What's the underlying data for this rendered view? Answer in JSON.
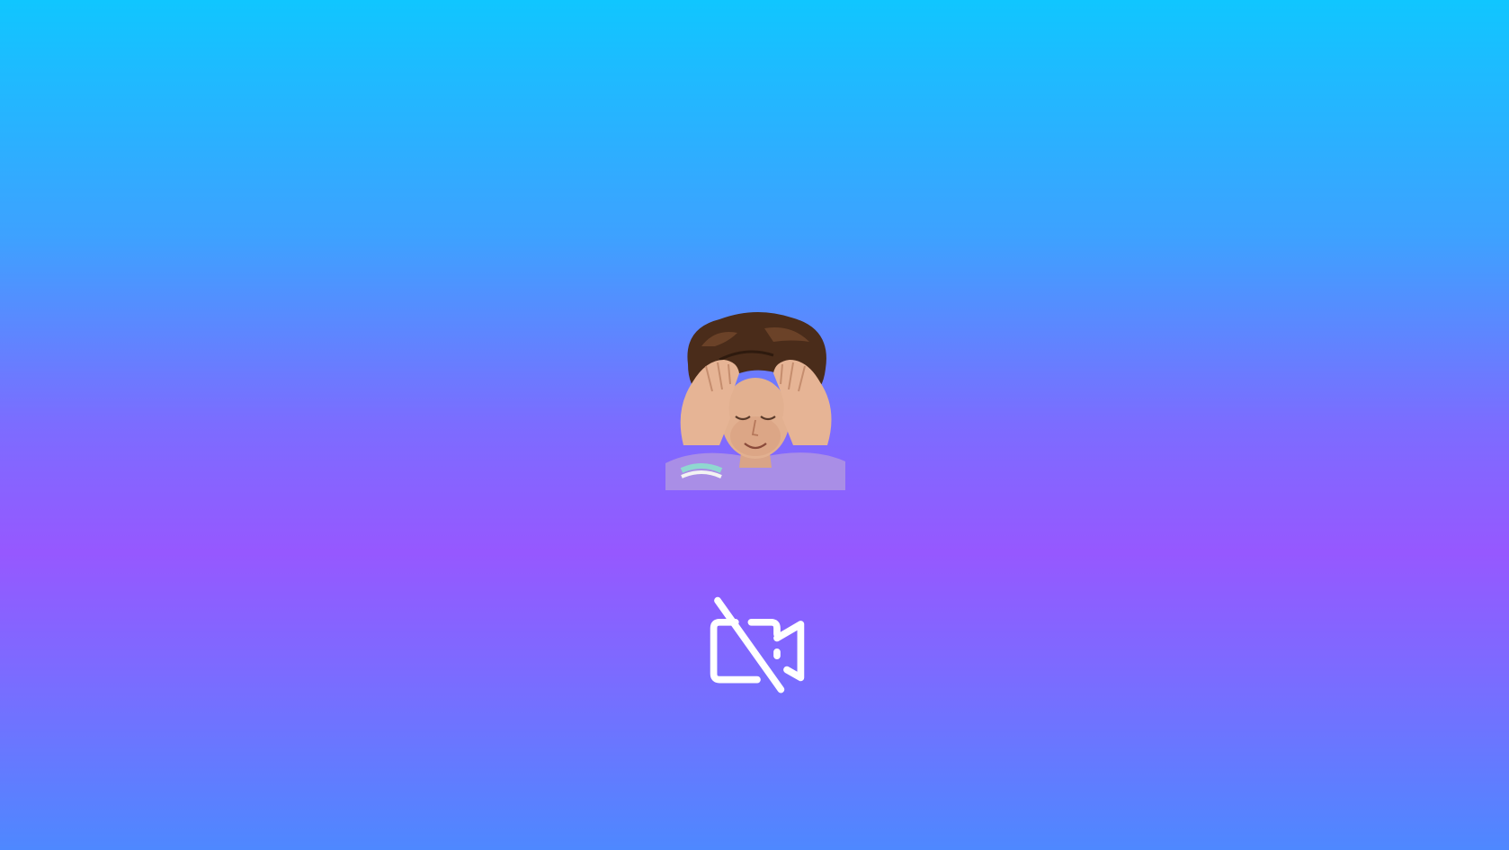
{
  "screen": {
    "background": {
      "gradient_colors": [
        "#10c6ff",
        "#3ea1ff",
        "#7c6cff",
        "#9658ff",
        "#7a6cff",
        "#4e88ff"
      ]
    }
  },
  "participant": {
    "avatar": {
      "type": "sticker",
      "icon": "person-facepalm-sticker"
    }
  },
  "controls": {
    "camera": {
      "state": "off",
      "icon": "video-off-icon",
      "color": "#ffffff"
    }
  }
}
